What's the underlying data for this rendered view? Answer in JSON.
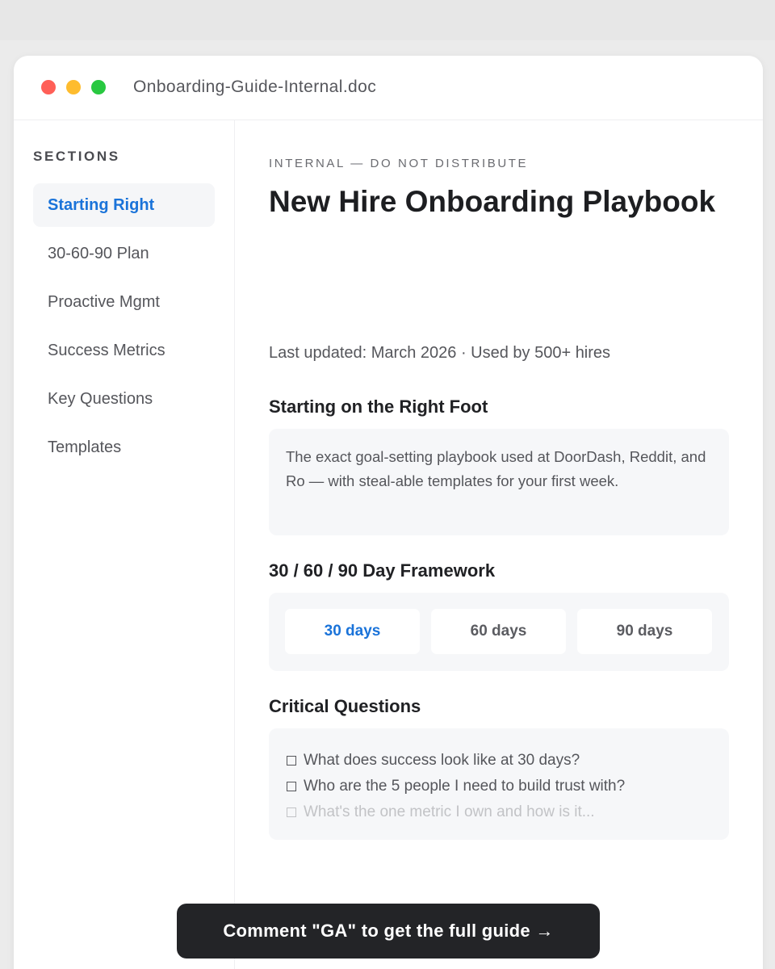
{
  "window": {
    "filename": "Onboarding-Guide-Internal.doc"
  },
  "sidebar": {
    "heading": "SECTIONS",
    "items": [
      {
        "label": "Starting Right",
        "active": true
      },
      {
        "label": "30-60-90 Plan",
        "active": false
      },
      {
        "label": "Proactive Mgmt",
        "active": false
      },
      {
        "label": "Success Metrics",
        "active": false
      },
      {
        "label": "Key Questions",
        "active": false
      },
      {
        "label": "Templates",
        "active": false
      }
    ]
  },
  "doc": {
    "eyebrow": "INTERNAL — DO NOT DISTRIBUTE",
    "title": "New Hire Onboarding Playbook",
    "meta": "Last updated: March 2026 · Used by 500+ hires",
    "sections": {
      "intro": {
        "title": "Starting on the Right Foot",
        "text": "The exact goal-setting playbook used at DoorDash, Reddit, and Ro — with steal-able templates for your first week."
      },
      "framework": {
        "title": "30 / 60 / 90 Day Framework",
        "tabs": [
          "30 days",
          "60 days",
          "90 days"
        ],
        "active_tab": "30 days"
      },
      "questions": {
        "title": "Critical Questions",
        "items": [
          "What does success look like at 30 days?",
          "Who are the 5 people I need to build trust with?",
          "What's the one metric I own and how is it..."
        ]
      }
    }
  },
  "cta": {
    "label": "Comment \"GA\" to get the full guide →"
  },
  "colors": {
    "accent": "#1a73d9",
    "cta_background": "#232427",
    "card_background": "#f6f7f9",
    "traffic_red": "#ff5f57",
    "traffic_yellow": "#febc2e",
    "traffic_green": "#28c840"
  }
}
